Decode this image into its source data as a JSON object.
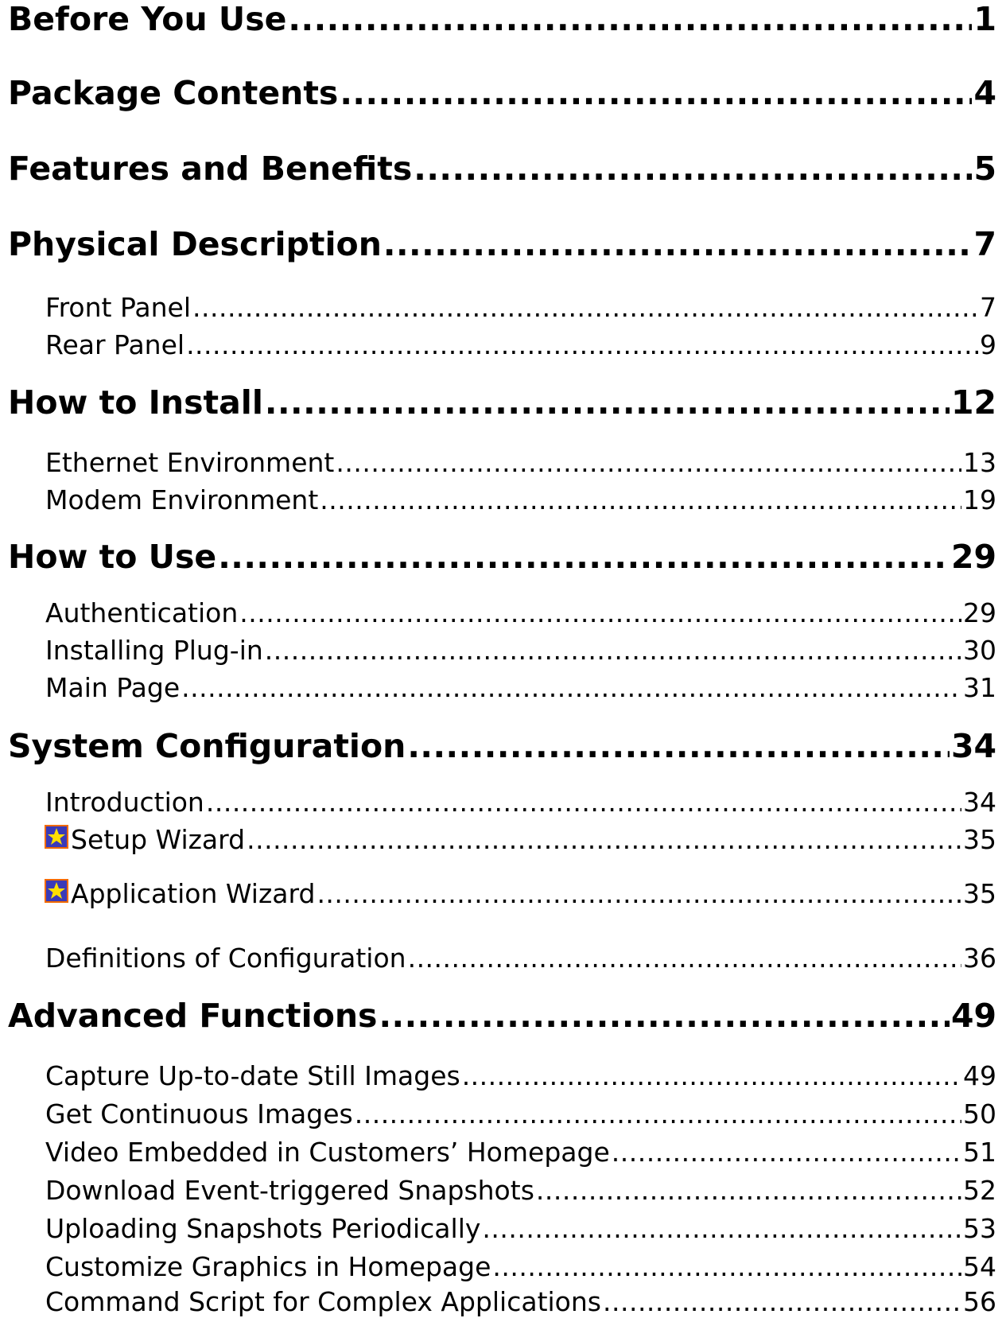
{
  "toc": [
    {
      "level": 1,
      "title": "Before You Use",
      "page": "1"
    },
    {
      "level": 1,
      "title": "Package Contents",
      "page": "4"
    },
    {
      "level": 1,
      "title": "Features and Benefits",
      "page": "5"
    },
    {
      "level": 1,
      "title": "Physical Description",
      "page": "7"
    },
    {
      "level": 2,
      "title": "Front Panel",
      "page": "7"
    },
    {
      "level": 2,
      "title": "Rear Panel",
      "page": "9"
    },
    {
      "level": 1,
      "title": "How to Install",
      "page": "12"
    },
    {
      "level": 2,
      "title": "Ethernet Environment",
      "page": "13"
    },
    {
      "level": 2,
      "title": "Modem Environment",
      "page": "19"
    },
    {
      "level": 1,
      "title": "How to Use",
      "page": "29"
    },
    {
      "level": 2,
      "title": "Authentication",
      "page": "29"
    },
    {
      "level": 2,
      "title": "Installing Plug-in",
      "page": "30"
    },
    {
      "level": 2,
      "title": "Main Page",
      "page": "31"
    },
    {
      "level": 1,
      "title": "System Configuration",
      "page": "34"
    },
    {
      "level": 2,
      "title": "Introduction",
      "page": "34"
    },
    {
      "level": 2,
      "title": "Setup Wizard",
      "page": "35",
      "icon": "wizard-star-icon"
    },
    {
      "level": 2,
      "title": "Application Wizard",
      "page": "35",
      "icon": "wizard-star-icon"
    },
    {
      "level": 2,
      "title": "Definitions of Configuration",
      "page": "36"
    },
    {
      "level": 1,
      "title": "Advanced Functions",
      "page": "49"
    },
    {
      "level": 2,
      "title": "Capture Up-to-date Still Images",
      "page": "49"
    },
    {
      "level": 2,
      "title": "Get Continuous Images",
      "page": "50"
    },
    {
      "level": 2,
      "title": "Video Embedded in Customers’ Homepage",
      "page": "51"
    },
    {
      "level": 2,
      "title": "Download Event-triggered Snapshots",
      "page": "52"
    },
    {
      "level": 2,
      "title": "Uploading Snapshots Periodically",
      "page": "53"
    },
    {
      "level": 2,
      "title": "Customize Graphics in Homepage",
      "page": "54"
    },
    {
      "level": 2,
      "title": "Command Script for Complex Applications",
      "page": "56"
    }
  ],
  "colors": {
    "text": "#000000",
    "icon_border": "#f26a00",
    "icon_fill": "#3a3ab8",
    "icon_star": "#ffe000"
  }
}
